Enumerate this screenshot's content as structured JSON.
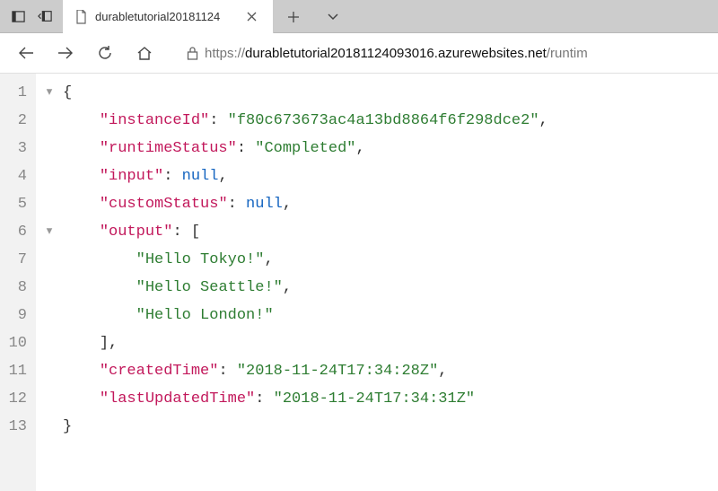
{
  "tab": {
    "title": "durabletutorial20181124"
  },
  "url": {
    "scheme": "https://",
    "host": "durabletutorial20181124093016.azurewebsites.net",
    "path": "/runtim"
  },
  "json": {
    "instanceId": "f80c673673ac4a13bd8864f6f298dce2",
    "runtimeStatus": "Completed",
    "input": "null",
    "customStatus": "null",
    "output": [
      "Hello Tokyo!",
      "Hello Seattle!",
      "Hello London!"
    ],
    "createdTime": "2018-11-24T17:34:28Z",
    "lastUpdatedTime": "2018-11-24T17:34:31Z"
  },
  "keys": {
    "instanceId": "instanceId",
    "runtimeStatus": "runtimeStatus",
    "input": "input",
    "customStatus": "customStatus",
    "output": "output",
    "createdTime": "createdTime",
    "lastUpdatedTime": "lastUpdatedTime"
  },
  "lines": [
    "1",
    "2",
    "3",
    "4",
    "5",
    "6",
    "7",
    "8",
    "9",
    "10",
    "11",
    "12",
    "13"
  ]
}
